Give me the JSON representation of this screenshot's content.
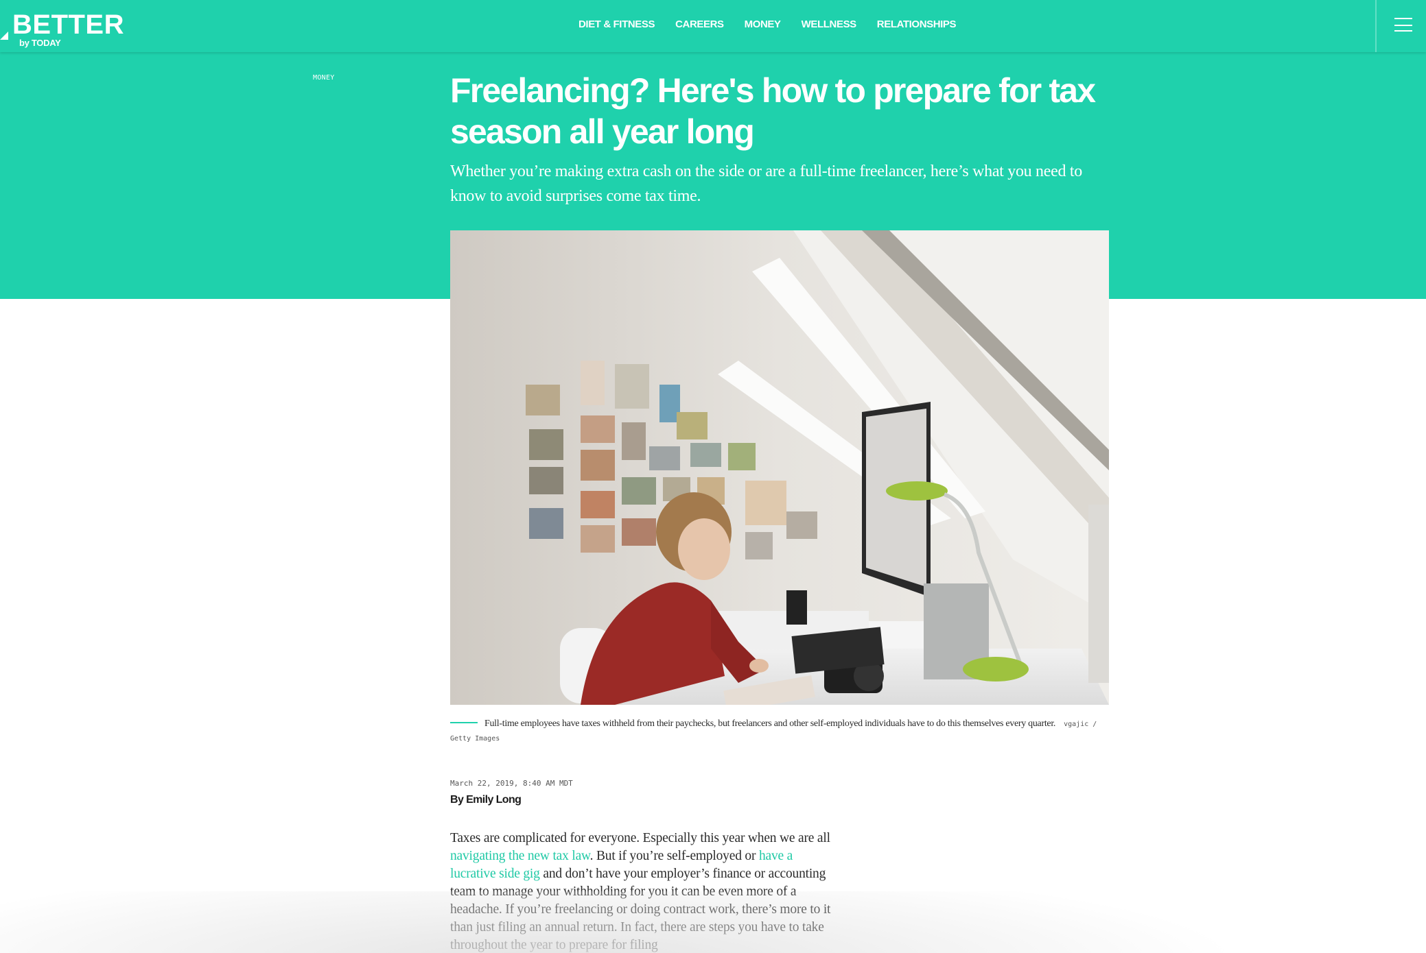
{
  "header": {
    "logo_main": "BETTER",
    "logo_sub": "by TODAY",
    "nav": [
      {
        "label": "DIET & FITNESS"
      },
      {
        "label": "CAREERS"
      },
      {
        "label": "MONEY"
      },
      {
        "label": "WELLNESS"
      },
      {
        "label": "RELATIONSHIPS"
      }
    ],
    "menu_icon": "hamburger-icon"
  },
  "article": {
    "section": "MONEY",
    "headline": "Freelancing? Here's how to prepare for tax season all year long",
    "dek": "Whether you’re making extra cash on the side or are a full-time freelancer, here’s what you need to know to avoid surprises come tax time.",
    "hero_image": {
      "alt": "Woman working at a desktop computer in a bright attic home office"
    },
    "caption": "Full-time employees have taxes withheld from their paychecks, but freelancers and other self-employed individuals have to do this themselves every quarter.",
    "caption_credit": "vgajic / Getty Images",
    "dateline": "March 22, 2019, 8:40 AM MDT",
    "byline": "By Emily Long",
    "body": {
      "p1_part1": "Taxes are complicated for everyone. Especially this year when we are all ",
      "link1": "navigating the new tax law",
      "p1_part2": ". But if you’re self-employed or ",
      "link2": "have a lucrative side gig",
      "p1_part3": " and don’t have your employer’s finance or accounting team to manage your withholding for you it can be even more of a headache. If you’re freelancing or doing contract work, there’s more to it than just filing an annual return. In fact, there are steps you have to take throughout the year to prepare for filing"
    }
  },
  "colors": {
    "brand": "#1fd1ac",
    "link": "#1fc9a5",
    "text": "#2b2b2b"
  }
}
